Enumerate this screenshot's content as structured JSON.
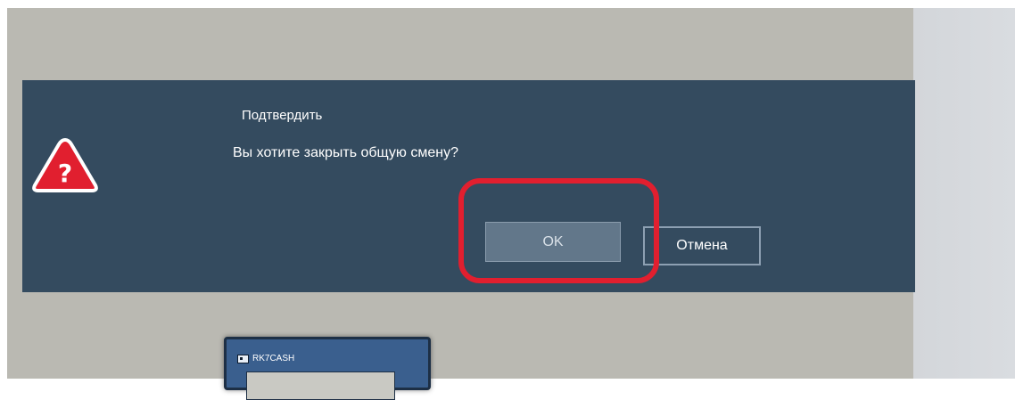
{
  "dialog": {
    "title": "Подтвердить",
    "message": "Вы хотите закрыть общую смену?",
    "icon": "warning-question-icon",
    "ok_label": "OK",
    "cancel_label": "Отмена"
  },
  "background_window": {
    "title": "RK7CASH"
  },
  "colors": {
    "dialog_bg": "#344b5f",
    "backdrop": "#bab9b2",
    "ok_button_bg": "#62778a",
    "annotation": "#e11f2f",
    "warning_icon": "#e11f2f"
  }
}
